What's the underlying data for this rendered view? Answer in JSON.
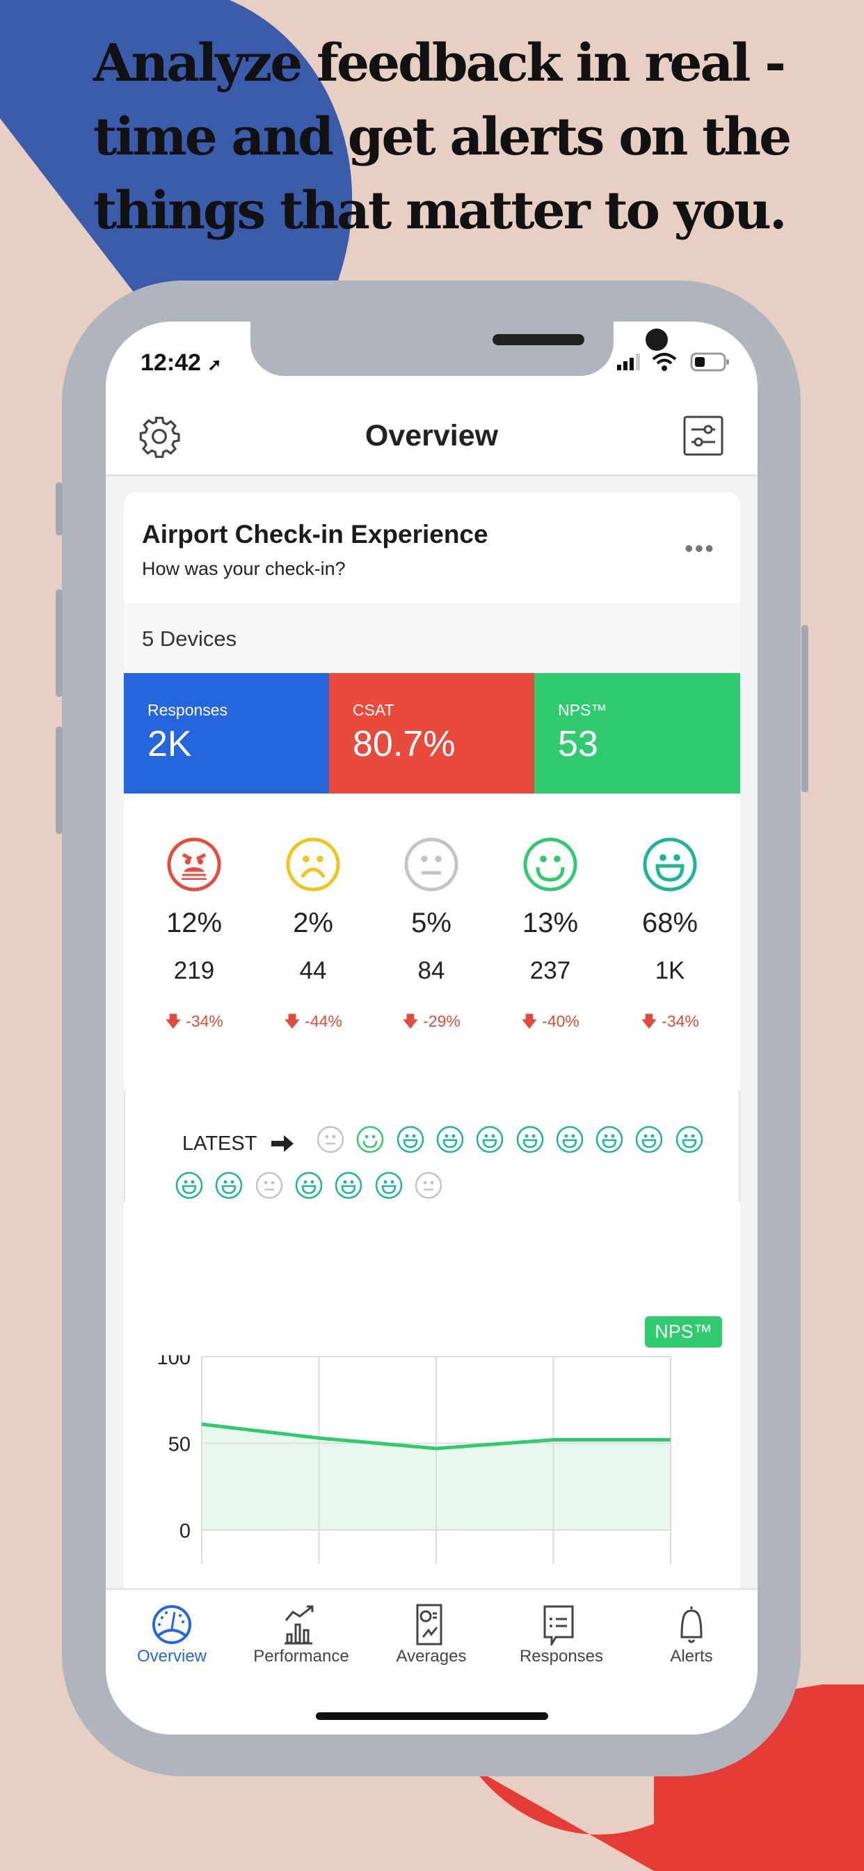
{
  "headline": "Analyze feedback in real -time and get alerts on the things that matter to you.",
  "colors": {
    "blue_shape": "#3b5bab",
    "red_shape": "#e53c35",
    "responses": "#2666dd",
    "csat": "#e84a3c",
    "nps": "#2fcb6e",
    "accent": "#2666dd"
  },
  "status_bar": {
    "time": "12:42",
    "icons": [
      "location-arrow-icon",
      "signal-icon",
      "wifi-icon",
      "battery-icon"
    ]
  },
  "nav": {
    "title": "Overview",
    "left_icon": "gear-icon",
    "right_icon": "filter-sliders-icon"
  },
  "card": {
    "title": "Airport Check-in Experience",
    "subtitle": "How was your check-in?",
    "menu_icon": "more-dots-icon",
    "devices": "5 Devices",
    "metrics": [
      {
        "label": "Responses",
        "value": "2K"
      },
      {
        "label": "CSAT",
        "value": "80.7%"
      },
      {
        "label": "NPS™",
        "value": "53"
      }
    ],
    "ratings": [
      {
        "face": "very-unhappy",
        "color": "#e84a3c",
        "percent": "12%",
        "count": "219",
        "change": "-34%"
      },
      {
        "face": "unhappy",
        "color": "#f0c419",
        "percent": "2%",
        "count": "44",
        "change": "-44%"
      },
      {
        "face": "neutral",
        "color": "#c4c4c4",
        "percent": "5%",
        "count": "84",
        "change": "-29%"
      },
      {
        "face": "happy",
        "color": "#2fcb6e",
        "percent": "13%",
        "count": "237",
        "change": "-40%"
      },
      {
        "face": "very-happy",
        "color": "#1bb597",
        "percent": "68%",
        "count": "1K",
        "change": "-34%"
      }
    ],
    "latest": {
      "label": "LATEST",
      "faces": [
        "neutral",
        "happy",
        "very-happy",
        "very-happy",
        "very-happy",
        "very-happy",
        "very-happy",
        "very-happy",
        "very-happy",
        "very-happy",
        "very-happy",
        "very-happy",
        "neutral",
        "very-happy",
        "very-happy",
        "very-happy",
        "neutral"
      ]
    }
  },
  "chart_data": {
    "type": "area",
    "series": [
      {
        "name": "NPS™",
        "values": [
          61,
          53,
          47,
          52,
          52
        ]
      }
    ],
    "x": [
      1,
      2,
      3,
      4,
      5
    ],
    "ylim": [
      0,
      100
    ],
    "yticks": [
      "100",
      "50",
      "0"
    ],
    "grid": true,
    "legend": "top-right",
    "color": "#2fcb6e"
  },
  "tabs": [
    {
      "label": "Overview",
      "icon": "dashboard-gauge-icon",
      "active": true
    },
    {
      "label": "Performance",
      "icon": "bar-chart-trend-icon",
      "active": false
    },
    {
      "label": "Averages",
      "icon": "report-icon",
      "active": false
    },
    {
      "label": "Responses",
      "icon": "chat-list-icon",
      "active": false
    },
    {
      "label": "Alerts",
      "icon": "bell-icon",
      "active": false
    }
  ]
}
